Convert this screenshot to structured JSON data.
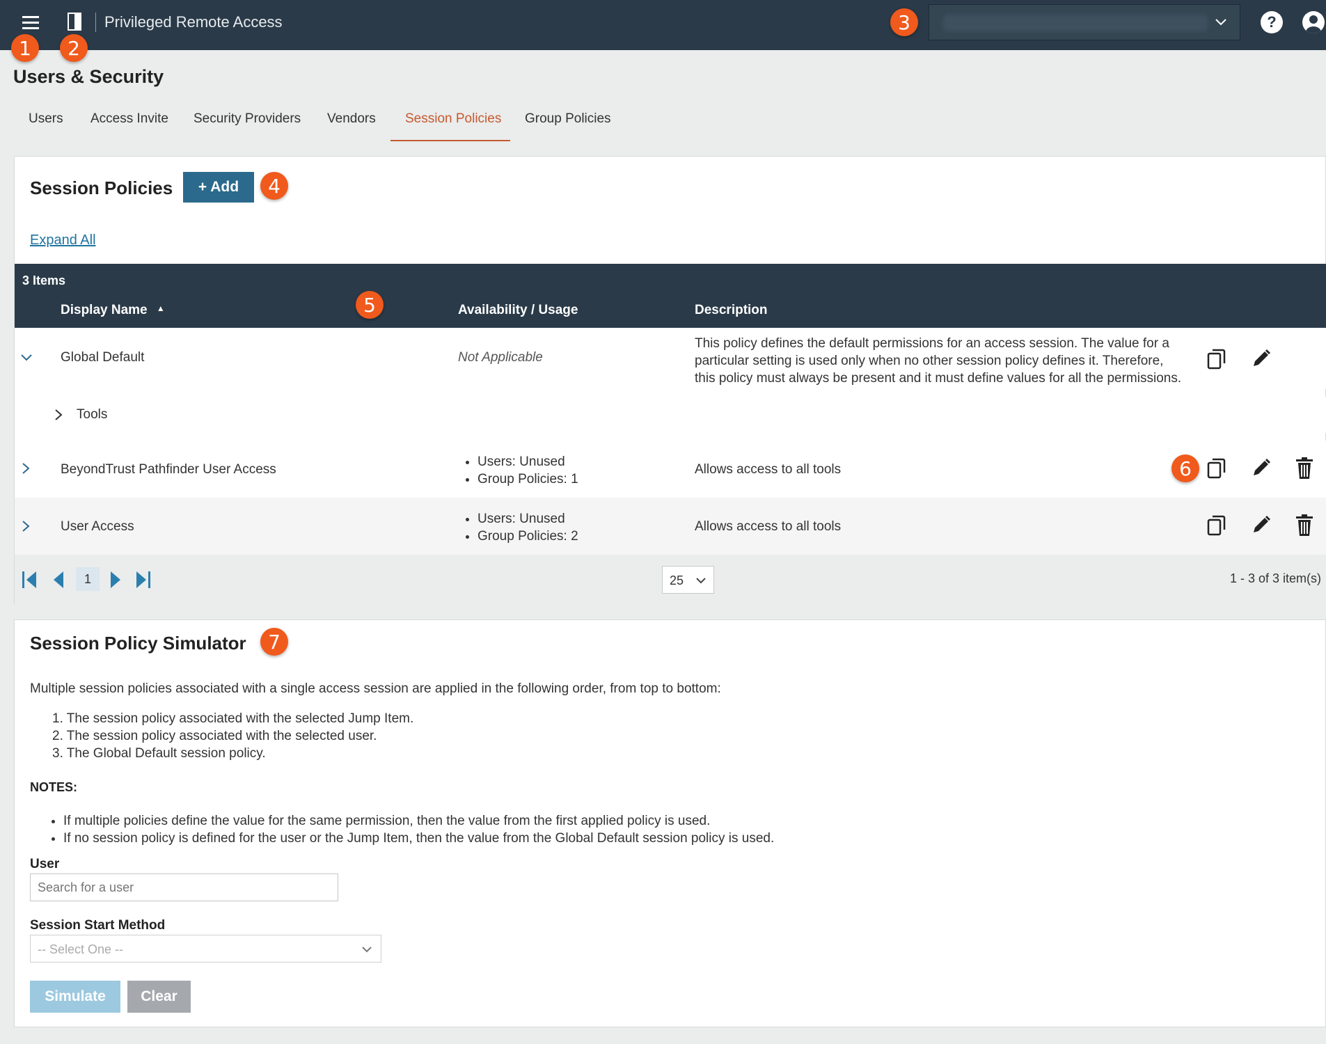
{
  "topbar": {
    "title": "Privileged Remote Access",
    "site_selector_value": ""
  },
  "page_title": "Users & Security",
  "tabs": [
    {
      "label": "Users"
    },
    {
      "label": "Access Invite"
    },
    {
      "label": "Security Providers"
    },
    {
      "label": "Vendors"
    },
    {
      "label": "Session Policies"
    },
    {
      "label": "Group Policies"
    }
  ],
  "active_tab": "Session Policies",
  "policies": {
    "title": "Session Policies",
    "add_label": "+ Add",
    "expand_all": "Expand All",
    "item_count": "3 Items",
    "columns": {
      "display_name": "Display Name",
      "availability": "Availability / Usage",
      "description": "Description"
    },
    "rows": [
      {
        "name": "Global Default",
        "availability": "Not Applicable",
        "description_lines": [
          "This policy defines the default permissions for an access session. The value for a",
          "particular setting is used only when no other session policy defines it. Therefore,",
          "this policy must always be present and it must define values for all the permissions."
        ],
        "sub": "Tools"
      },
      {
        "name": "BeyondTrust Pathfinder User Access",
        "usage": [
          "Users: Unused",
          "Group Policies: 1"
        ],
        "description": "Allows access to all tools"
      },
      {
        "name": "User Access",
        "usage": [
          "Users: Unused",
          "Group Policies: 2"
        ],
        "description": "Allows access to all tools"
      }
    ],
    "pager": {
      "page": "1",
      "page_size": "25",
      "summary": "1 - 3 of 3 item(s)"
    }
  },
  "simulator": {
    "title": "Session Policy Simulator",
    "intro": "Multiple session policies associated with a single access session are applied in the following order, from top to bottom:",
    "order": [
      "1. The session policy associated with the selected Jump Item.",
      "2. The session policy associated with the selected user.",
      "3. The Global Default session policy."
    ],
    "notes_label": "NOTES:",
    "notes": [
      "If multiple policies define the value for the same permission, then the value from the first applied policy is used.",
      "If no session policy is defined for the user or the Jump Item, then the value from the Global Default session policy is used."
    ],
    "user_label": "User",
    "user_placeholder": "Search for a user",
    "method_label": "Session Start Method",
    "method_value": "-- Select One --",
    "simulate_label": "Simulate",
    "clear_label": "Clear"
  },
  "callouts": [
    "1",
    "2",
    "3",
    "4",
    "5",
    "6",
    "7"
  ],
  "colors": {
    "topbar": "#2a3a48",
    "accent_orange": "#f05a1c",
    "active_tab": "#c55a2e",
    "add_button": "#2b6a8c",
    "link": "#1e73a0"
  }
}
